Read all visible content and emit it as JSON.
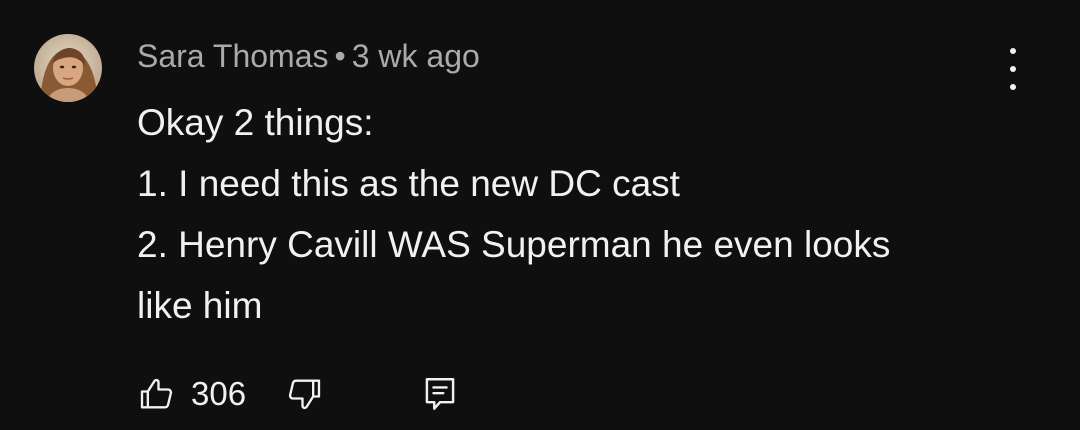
{
  "comment": {
    "author": "Sara Thomas",
    "separator": "•",
    "time": "3 wk ago",
    "lines": [
      "Okay 2 things:",
      "1. I need this as the new DC cast",
      "2. Henry Cavill WAS Superman he even looks",
      "like him"
    ],
    "like_count": "306"
  },
  "icons": {
    "like": "thumbs-up-icon",
    "dislike": "thumbs-down-icon",
    "reply": "reply-comment-icon",
    "menu": "more-vert-icon"
  },
  "colors": {
    "background": "#0f0f0f",
    "text": "#f1f1f1",
    "meta_text": "#aaaaaa"
  }
}
